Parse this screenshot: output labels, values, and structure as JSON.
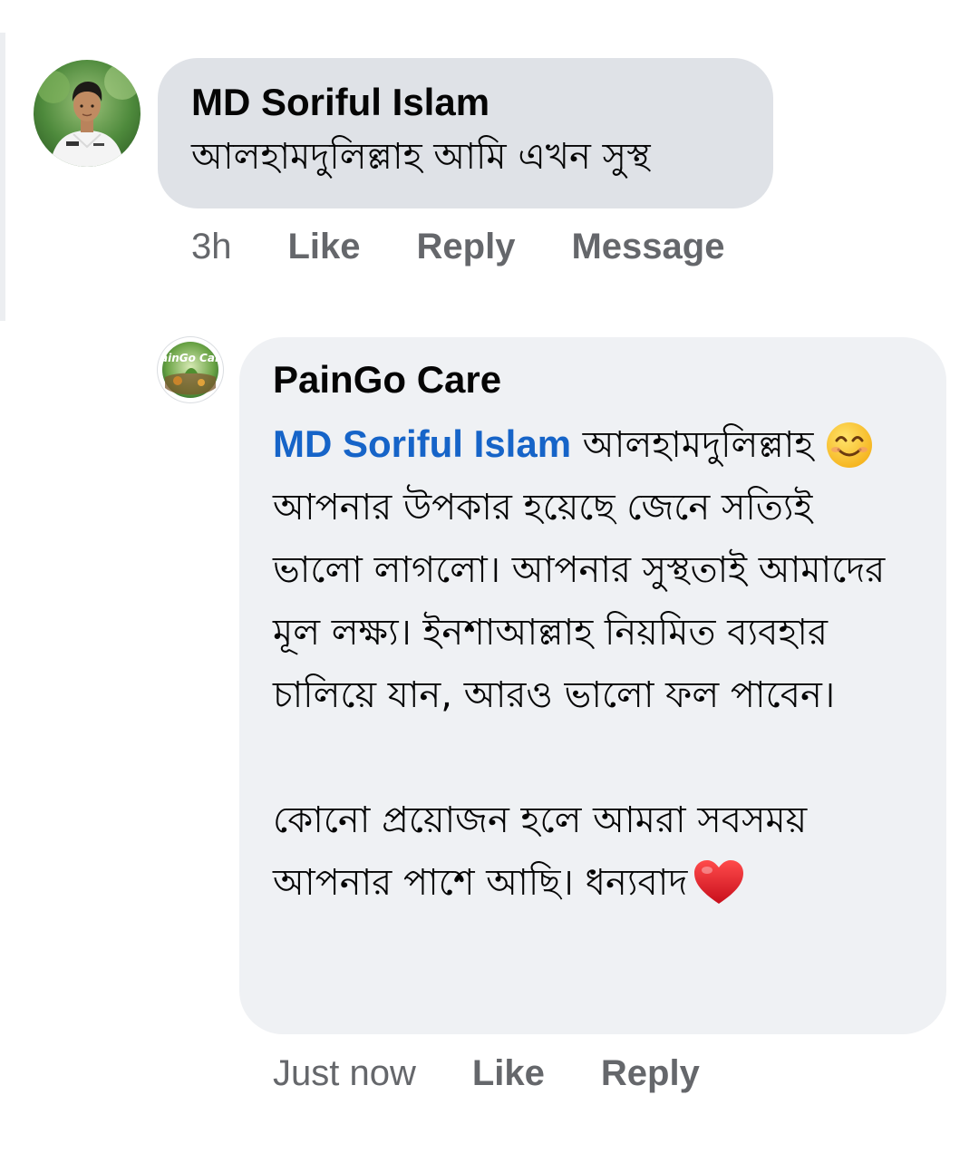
{
  "comments": [
    {
      "author": "MD Soriful Islam",
      "avatar_icon": "profile-photo",
      "text": "আলহামদুলিল্লাহ আমি এখন সুস্থ",
      "time": "3h",
      "actions": {
        "like": "Like",
        "reply": "Reply",
        "message": "Message"
      }
    },
    {
      "author": "PainGo Care",
      "avatar_icon": "paingo-care-logo",
      "logo_text": "PainGo Care",
      "mention": "MD Soriful Islam",
      "intro": "আলহামদুলিল্লাহ",
      "smile_emoji": "smiling-face-emoji",
      "paragraph_1": "আপনার উপকার হয়েছে জেনে সত্যিই ভালো লাগলো। আপনার সুস্থতাই আমাদের মূল লক্ষ্য। ইনশাআল্লাহ নিয়মিত ব্যবহার চালিয়ে যান, আরও ভালো ফল পাবেন।",
      "paragraph_2": "কোনো প্রয়োজন হলে আমরা সবসময় আপনার পাশে আছি। ধন্যবাদ",
      "heart_emoji": "red-heart-emoji",
      "time": "Just now",
      "actions": {
        "like": "Like",
        "reply": "Reply"
      }
    }
  ],
  "colors": {
    "bubble_primary": "#dfe2e7",
    "bubble_reply": "#eff1f4",
    "mention": "#1664c8",
    "meta_text": "#65676b",
    "text": "#050505"
  }
}
